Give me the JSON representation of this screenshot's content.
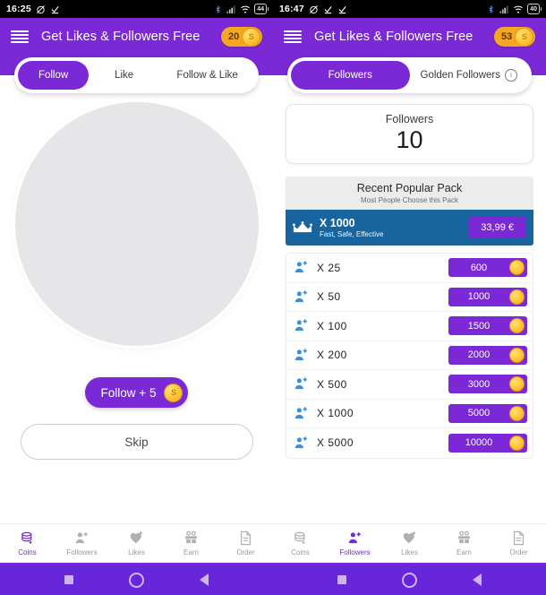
{
  "left": {
    "statusbar": {
      "time": "16:25",
      "battery": "44",
      "icons": [
        "alarm-off-icon",
        "download-done-icon",
        "bluetooth-icon",
        "signal-icon",
        "wifi-icon",
        "battery-icon"
      ]
    },
    "header": {
      "title": "Get Likes & Followers Free",
      "coins": "20",
      "menu_icon": "hamburger-icon",
      "coin_icon": "coin-icon"
    },
    "tabs": [
      {
        "label": "Follow",
        "active": true
      },
      {
        "label": "Like",
        "active": false
      },
      {
        "label": "Follow & Like",
        "active": false
      }
    ],
    "avatar": {
      "name": "profile-avatar-placeholder"
    },
    "follow_button": {
      "label": "Follow + 5",
      "coin_icon": "coin-icon"
    },
    "skip_button": {
      "label": "Skip"
    },
    "bottom_nav": [
      {
        "label": "Coins",
        "icon": "coins-stack-icon",
        "active": true
      },
      {
        "label": "Followers",
        "icon": "person-add-icon",
        "active": false
      },
      {
        "label": "Likes",
        "icon": "heart-plus-icon",
        "active": false
      },
      {
        "label": "Earn",
        "icon": "gift-icon",
        "active": false
      },
      {
        "label": "Order",
        "icon": "document-icon",
        "active": false
      }
    ]
  },
  "right": {
    "statusbar": {
      "time": "16:47",
      "battery": "40",
      "icons": [
        "alarm-off-icon",
        "download-done-icon",
        "download-done-icon",
        "bluetooth-icon",
        "signal-icon",
        "wifi-icon",
        "battery-icon"
      ]
    },
    "header": {
      "title": "Get Likes & Followers Free",
      "coins": "53",
      "menu_icon": "hamburger-icon",
      "coin_icon": "coin-icon"
    },
    "tabs": [
      {
        "label": "Followers",
        "active": true
      },
      {
        "label": "Golden Followers",
        "active": false,
        "info_icon": "info-icon"
      }
    ],
    "followers_card": {
      "label": "Followers",
      "value": "10"
    },
    "popular_pack": {
      "title": "Recent Popular Pack",
      "subtitle": "Most People Choose this Pack",
      "crown_icon": "crown-icon",
      "quantity": "X 1000",
      "tagline": "Fast, Safe, Effective",
      "price": "33,99 €"
    },
    "packages": [
      {
        "icon": "person-add-icon",
        "quantity": "X  25",
        "cost": "600",
        "coin_icon": "coin-icon"
      },
      {
        "icon": "person-add-icon",
        "quantity": "X  50",
        "cost": "1000",
        "coin_icon": "coin-icon"
      },
      {
        "icon": "person-add-icon",
        "quantity": "X  100",
        "cost": "1500",
        "coin_icon": "coin-icon"
      },
      {
        "icon": "person-add-icon",
        "quantity": "X  200",
        "cost": "2000",
        "coin_icon": "coin-icon"
      },
      {
        "icon": "person-add-icon",
        "quantity": "X  500",
        "cost": "3000",
        "coin_icon": "coin-icon"
      },
      {
        "icon": "person-add-icon",
        "quantity": "X  1000",
        "cost": "5000",
        "coin_icon": "coin-icon"
      },
      {
        "icon": "person-add-icon",
        "quantity": "X  5000",
        "cost": "10000",
        "coin_icon": "coin-icon"
      }
    ],
    "bottom_nav": [
      {
        "label": "Coins",
        "icon": "coins-stack-icon",
        "active": false
      },
      {
        "label": "Followers",
        "icon": "person-add-icon",
        "active": true
      },
      {
        "label": "Likes",
        "icon": "heart-plus-icon",
        "active": false
      },
      {
        "label": "Earn",
        "icon": "gift-icon",
        "active": false
      },
      {
        "label": "Order",
        "icon": "document-icon",
        "active": false
      }
    ]
  },
  "system_nav": {
    "recents_icon": "square-recents-icon",
    "home_icon": "circle-home-icon",
    "back_icon": "triangle-back-icon"
  },
  "colors": {
    "brand_purple": "#7B29D6",
    "sysnav_purple": "#6726D9",
    "pack_blue": "#18649E",
    "coin_gold": "#F5A623",
    "icon_blue": "#3C8FD6"
  }
}
